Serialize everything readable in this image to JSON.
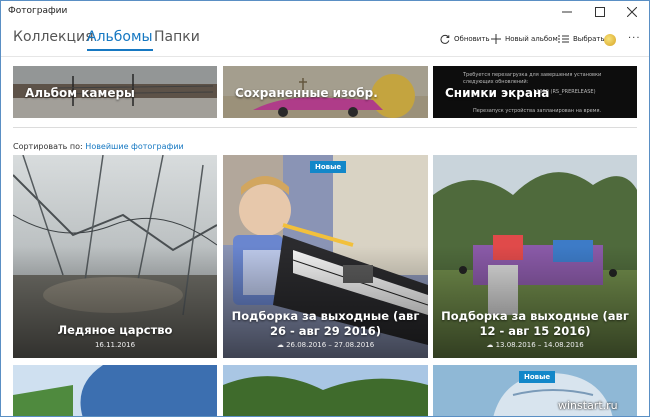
{
  "window": {
    "title": "Фотографии"
  },
  "nav": {
    "tabs": [
      {
        "label": "Коллекция"
      },
      {
        "label": "Альбомы"
      },
      {
        "label": "Папки"
      }
    ],
    "commands": {
      "refresh": "Обновить",
      "new_album": "Новый альбом",
      "select": "Выбрать"
    }
  },
  "folders": [
    {
      "label": "Альбом камеры"
    },
    {
      "label": "Сохраненные изобр."
    },
    {
      "label": "Снимки экрана"
    }
  ],
  "screenshot_tile": {
    "line1": "Требуется перезагрузка для завершения установки",
    "line2": "следующих обновлений:",
    "line3": "14959 (RS_PRERELEASE)",
    "line4": "Перезапуск устройства запланирован на время."
  },
  "sort": {
    "label": "Сортировать по:",
    "value": "Новейшие фотографии"
  },
  "albums": [
    {
      "title": "Ледяное царство",
      "date": "16.11.2016",
      "badge": ""
    },
    {
      "title": "Подборка за выходные (авг 26 - авг 29 2016)",
      "date": "26.08.2016 – 27.08.2016",
      "badge": "Новые"
    },
    {
      "title": "Подборка за выходные (авг 12 - авг 15 2016)",
      "date": "13.08.2016 – 14.08.2016",
      "badge": ""
    }
  ],
  "row2": [
    {
      "badge": ""
    },
    {
      "badge": ""
    },
    {
      "badge": "Новые"
    }
  ],
  "watermark": "winstart.ru",
  "colors": {
    "accent": "#1678c2",
    "badge": "#1287c9"
  }
}
